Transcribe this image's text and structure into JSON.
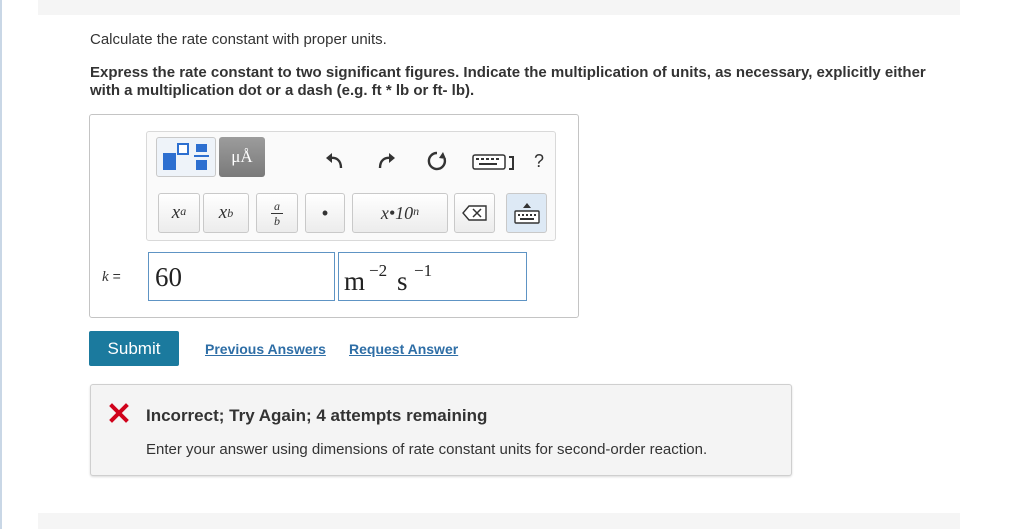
{
  "question": {
    "prompt": "Calculate the rate constant with proper units.",
    "instructions": "Express the rate constant to two significant figures. Indicate the multiplication of units, as necessary, explicitly either with a multiplication dot or a dash (e.g. ft * lb or ft- lb)."
  },
  "toolbar": {
    "units_label": "μÅ",
    "help_label": "?",
    "superscript_base": "x",
    "superscript_exp": "a",
    "subscript_base": "x",
    "subscript_sub": "b",
    "fraction_num": "a",
    "fraction_den": "b",
    "dot_label": "•",
    "scientific_label": "x•10",
    "scientific_exp": "n"
  },
  "answer": {
    "variable_label": "k",
    "equals": "=",
    "value": "60",
    "unit_1": "m",
    "unit_1_exp": "−2",
    "unit_2": "s",
    "unit_2_exp": "−1"
  },
  "actions": {
    "submit_label": "Submit",
    "previous_answers_label": "Previous Answers",
    "request_answer_label": "Request Answer"
  },
  "feedback": {
    "title": "Incorrect; Try Again; 4 attempts remaining",
    "message": "Enter your answer using dimensions of rate constant units for second-order reaction.",
    "error_color": "#d0021b"
  },
  "colors": {
    "accent": "#1b7a9e",
    "link": "#2e6ea6",
    "input_border": "#5e94c4"
  }
}
